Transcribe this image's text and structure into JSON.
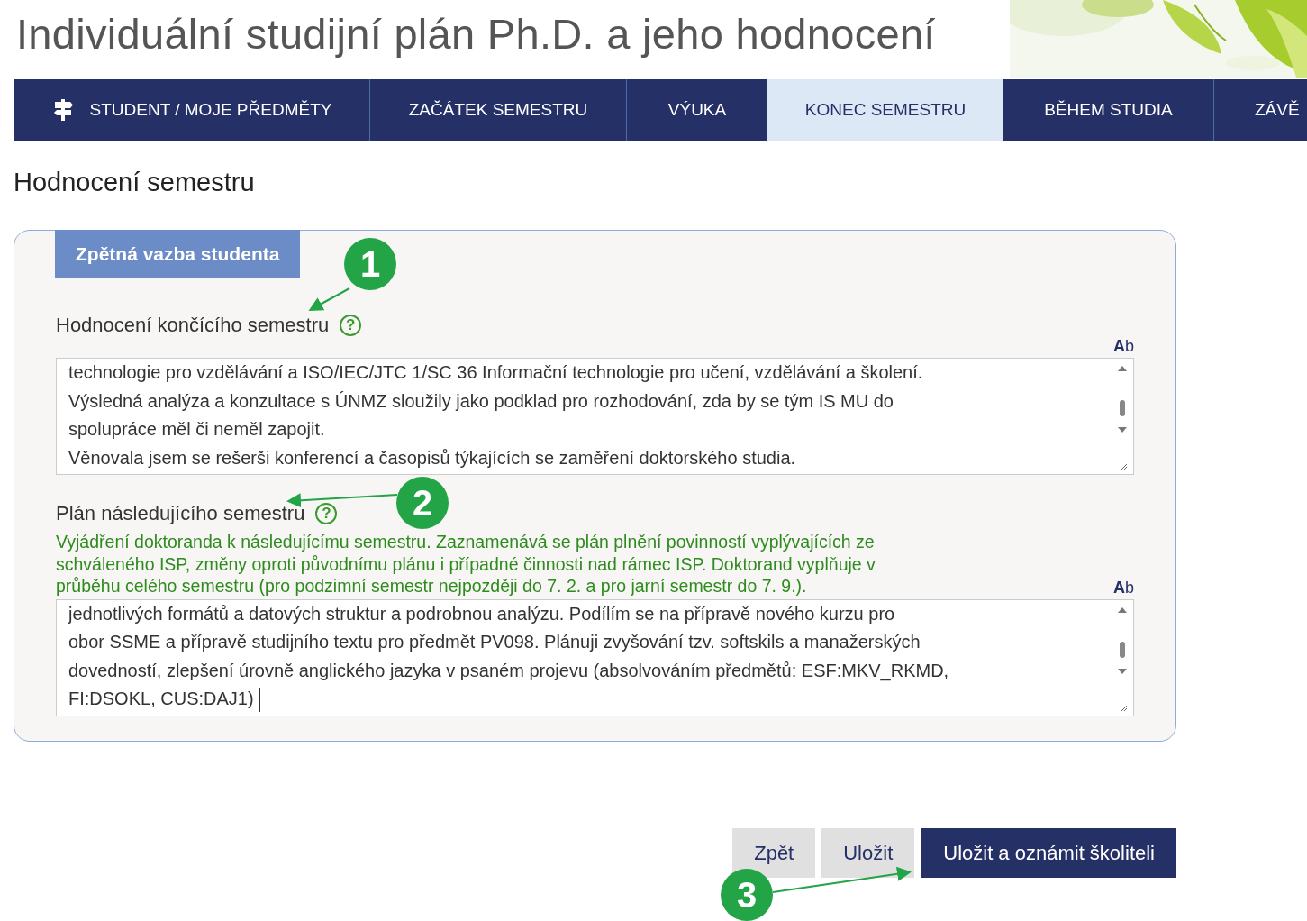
{
  "page_title": "Individuální studijní plán Ph.D. a jeho hodnocení",
  "nav": [
    {
      "label": "STUDENT / MOJE PŘEDMĚTY",
      "selected": false,
      "kind": "home"
    },
    {
      "label": "ZAČÁTEK SEMESTRU",
      "selected": false,
      "kind": "plain"
    },
    {
      "label": "VÝUKA",
      "selected": false,
      "kind": "plain"
    },
    {
      "label": "KONEC SEMESTRU",
      "selected": true,
      "kind": "plain"
    },
    {
      "label": "BĚHEM STUDIA",
      "selected": false,
      "kind": "plain"
    },
    {
      "label": "ZÁVĚ",
      "selected": false,
      "kind": "plain"
    }
  ],
  "section_title": "Hodnocení semestru",
  "panel": {
    "legend": "Zpětná vazba studenta",
    "fields": [
      {
        "label": "Hodnocení končícího semestru",
        "help": "?",
        "toggle": "**A**b",
        "lines": [
          "technologie pro vzdělávání a ISO/IEC/JTC 1/SC 36 Informační technologie pro učení, vzdělávání a školení.",
          "Výsledná analýza a konzultace s ÚNMZ sloužily jako podklad pro rozhodování, zda by se tým IS MU do",
          "spolupráce měl či neměl zapojit.",
          "Věnovala jsem se rešerši konferencí a časopisů týkajících se zaměření doktorského studia."
        ]
      },
      {
        "label": "Plán následujícího semestru",
        "help": "?",
        "hint": [
          "Vyjádření doktoranda k následujícímu semestru. Zaznamenává se plán plnění povinností vyplývajících ze",
          "schváleného ISP, změny oproti původnímu plánu i případné činnosti nad rámec ISP. Doktorand vyplňuje v",
          "průběhu celého semestru (pro podzimní semestr nejpozději do 7. 2. a pro jarní semestr do 7. 9.)."
        ],
        "toggle": "**A**b",
        "lines": [
          "jednotlivých formátů a datových struktur a podrobnou analýzu. Podílím se na přípravě nového kurzu pro",
          "obor SSME a přípravě studijního textu pro předmět PV098. Plánuji zvyšování tzv. softskils a manažerských",
          "dovedností, zlepšení úrovně anglického jazyka v psaném projevu (absolvováním předmětů: ESF:MKV_RKMD,",
          "FI:DSOKL, CUS:DAJ1)"
        ]
      }
    ]
  },
  "buttons": [
    {
      "label": "Zpět",
      "kind": "secondary"
    },
    {
      "label": "Uložit",
      "kind": "secondary"
    },
    {
      "label": "Uložit a oznámit školiteli",
      "kind": "primary"
    }
  ],
  "callouts": [
    "1",
    "2",
    "3"
  ]
}
